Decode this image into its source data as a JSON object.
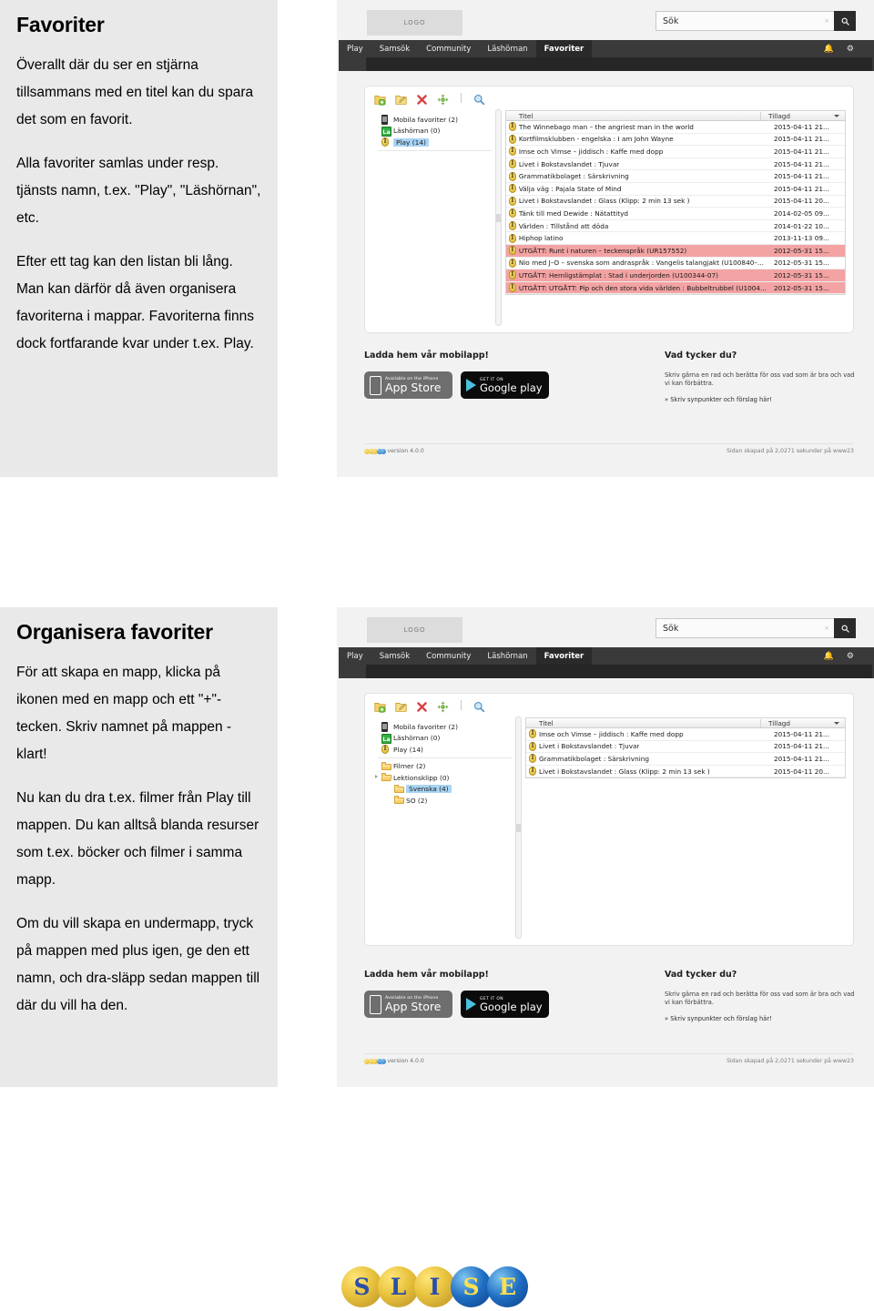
{
  "notes": [
    {
      "title": "Favoriter",
      "paragraphs": [
        "Överallt där du ser en stjärna tillsammans med en titel kan du spara det som en favorit.",
        "Alla favoriter samlas under resp. tjänsts namn, t.ex. \"Play\", \"Läshörnan\", etc.",
        "Efter ett tag kan den listan bli lång. Man kan därför då även organisera favoriterna i mappar. Favoriterna finns dock fortfarande kvar under t.ex. Play."
      ]
    },
    {
      "title": "Organisera favoriter",
      "paragraphs": [
        "För att skapa en mapp, klicka på ikonen med en mapp och ett \"+\"-tecken. Skriv namnet på mappen - klart!",
        "Nu kan du dra t.ex. filmer från Play till mappen. Du kan alltså blanda resurser som t.ex. böcker och filmer i samma mapp.",
        "Om du vill skapa en undermapp, tryck på mappen med plus igen, ge den ett namn, och dra-släpp sedan mappen till där du vill ha den."
      ]
    }
  ],
  "app": {
    "logo_label": "LOGO",
    "search": {
      "value": "Sök",
      "clear_icon": "×",
      "button_icon": "⚲"
    },
    "nav_items": [
      "Play",
      "Samsök",
      "Community",
      "Läshörnan",
      "Favoriter"
    ],
    "nav_active": "Favoriter",
    "nav_right_icons": [
      "bell-icon",
      "gear-icon"
    ],
    "toolbar": [
      {
        "name": "new-folder-icon",
        "title": "Ny mapp"
      },
      {
        "name": "edit-folder-icon",
        "title": "Byt namn"
      },
      {
        "name": "delete-icon",
        "title": "Ta bort"
      },
      {
        "name": "move-icon",
        "title": "Flytta"
      },
      {
        "name": "separator",
        "title": ""
      },
      {
        "name": "search-icon",
        "title": "Sök"
      }
    ],
    "columns": {
      "title": "Titel",
      "added": "Tillagd"
    },
    "footer": {
      "app_heading": "Ladda hem vår mobilapp!",
      "appstore": {
        "small": "Available on the iPhone",
        "big": "App Store"
      },
      "googleplay": {
        "small": "GET IT ON",
        "big": "Google play"
      },
      "feedback_heading": "Vad tycker du?",
      "feedback_text": "Skriv gärna en rad och berätta för oss vad som är bra och vad vi kan förbättra.",
      "feedback_link": "» Skriv synpunkter och förslag här!",
      "version": "version 4.0.0",
      "created": "Sidan skapad på 2,0271 sekunder på www23"
    }
  },
  "shot1": {
    "tree": [
      {
        "icon": "phone-icon",
        "label": "Mobila favoriter (2)",
        "indent": 0,
        "selected": false,
        "toggle": false
      },
      {
        "icon": "lashornan-icon",
        "label": "Läshörnan (0)",
        "indent": 0,
        "selected": false,
        "toggle": false
      },
      {
        "icon": "media-icon",
        "label": "Play (14)",
        "indent": 0,
        "selected": true,
        "toggle": false
      }
    ],
    "rows": [
      {
        "title": "The Winnebago man – the angriest man in the world",
        "added": "2015-04-11 21...",
        "expired": false
      },
      {
        "title": "Kortfilmsklubben - engelska : I am John Wayne",
        "added": "2015-04-11 21...",
        "expired": false
      },
      {
        "title": "Imse och Vimse – jiddisch : Kaffe med dopp",
        "added": "2015-04-11 21...",
        "expired": false
      },
      {
        "title": "Livet i Bokstavslandet : Tjuvar",
        "added": "2015-04-11 21...",
        "expired": false
      },
      {
        "title": "Grammatikbolaget : Särskrivning",
        "added": "2015-04-11 21...",
        "expired": false
      },
      {
        "title": "Välja väg : Pajala State of Mind",
        "added": "2015-04-11 21...",
        "expired": false
      },
      {
        "title": "Livet i Bokstavslandet : Glass (Klipp: 2 min 13 sek )",
        "added": "2015-04-11 20...",
        "expired": false
      },
      {
        "title": "Tänk till med Dewide : Nätattityd",
        "added": "2014-02-05 09...",
        "expired": false
      },
      {
        "title": "Världen : Tillstånd att döda",
        "added": "2014-01-22 10...",
        "expired": false
      },
      {
        "title": "Hiphop latino",
        "added": "2013-11-13 09...",
        "expired": false
      },
      {
        "title": "UTGÅTT: Runt i naturen – teckenspråk (UR157552)",
        "added": "2012-05-31 15...",
        "expired": true
      },
      {
        "title": "Nio med J–O – svenska som andraspråk : Vangelis talangjakt (U100840–...",
        "added": "2012-05-31 15...",
        "expired": false
      },
      {
        "title": "UTGÅTT: Hemligstämplat : Stad i underjorden (U100344-07)",
        "added": "2012-05-31 15...",
        "expired": true
      },
      {
        "title": "UTGÅTT: UTGÅTT: Pip och den stora vida världen : Bubbeltrubbel (U1004...",
        "added": "2012-05-31 15...",
        "expired": true
      }
    ]
  },
  "shot2": {
    "tree": [
      {
        "icon": "phone-icon",
        "label": "Mobila favoriter (2)",
        "indent": 0,
        "selected": false,
        "toggle": false
      },
      {
        "icon": "lashornan-icon",
        "label": "Läshörnan (0)",
        "indent": 0,
        "selected": false,
        "toggle": false
      },
      {
        "icon": "media-icon",
        "label": "Play (14)",
        "indent": 0,
        "selected": false,
        "toggle": false
      },
      {
        "icon": "separator",
        "label": "",
        "indent": 0,
        "selected": false,
        "toggle": false
      },
      {
        "icon": "folder-icon",
        "label": "Filmer (2)",
        "indent": 0,
        "selected": false,
        "toggle": false
      },
      {
        "icon": "folder-open-icon",
        "label": "Lektionsklipp (0)",
        "indent": 0,
        "selected": false,
        "toggle": true
      },
      {
        "icon": "folder-icon",
        "label": "Svenska (4)",
        "indent": 1,
        "selected": true,
        "toggle": false
      },
      {
        "icon": "folder-icon",
        "label": "SO (2)",
        "indent": 1,
        "selected": false,
        "toggle": false
      }
    ],
    "rows": [
      {
        "title": "Imse och Vimse – jiddisch : Kaffe med dopp",
        "added": "2015-04-11 21...",
        "expired": false
      },
      {
        "title": "Livet i Bokstavslandet : Tjuvar",
        "added": "2015-04-11 21...",
        "expired": false
      },
      {
        "title": "Grammatikbolaget : Särskrivning",
        "added": "2015-04-11 21...",
        "expired": false
      },
      {
        "title": "Livet i Bokstavslandet : Glass (Klipp: 2 min 13 sek )",
        "added": "2015-04-11 20...",
        "expired": false
      }
    ]
  },
  "brand": {
    "name": "SLISE",
    "letters": [
      {
        "char": "S",
        "style": "gold"
      },
      {
        "char": "L",
        "style": "gold"
      },
      {
        "char": "I",
        "style": "gold"
      },
      {
        "char": "S",
        "style": "blue"
      },
      {
        "char": "E",
        "style": "blue"
      }
    ]
  },
  "colors": {
    "note_bg": "#e9e9e9",
    "nav_bg": "#3a3a3a",
    "nav_active_bg": "#2a2a2a",
    "expired_row": "#f3a3a3",
    "selection": "#a9d5f5",
    "brand_gold": "#e8c23c",
    "brand_blue": "#1f6fc4"
  }
}
